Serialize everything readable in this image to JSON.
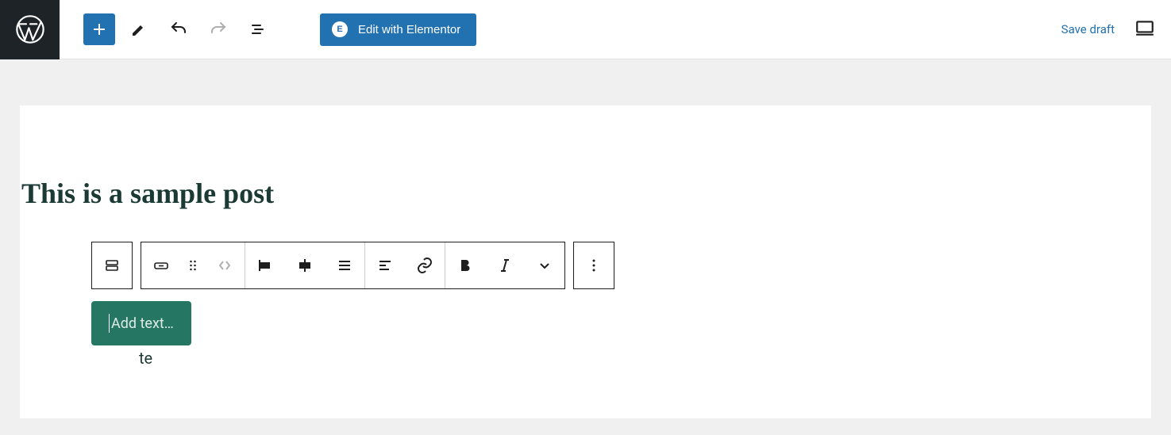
{
  "toolbar": {
    "elementor_label": "Edit with Elementor",
    "save_draft_label": "Save draft"
  },
  "post": {
    "title": "This is a sample post"
  },
  "block": {
    "behind_fragment": "te",
    "button_placeholder": "Add text…"
  }
}
